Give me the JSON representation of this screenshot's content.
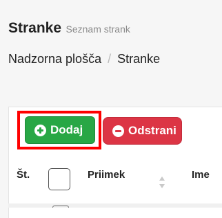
{
  "header": {
    "title": "Stranke",
    "subtitle": "Seznam strank"
  },
  "breadcrumb": {
    "items": [
      "Nadzorna plošča",
      "Stranke"
    ],
    "separator": "/"
  },
  "toolbar": {
    "add_label": "Dodaj",
    "add_icon": "plus-circle-icon",
    "remove_label": "Odstrani",
    "remove_icon": "minus-circle-icon",
    "add_color": "#28a745",
    "remove_color": "#dc3545",
    "highlight_color": "#ff0000"
  },
  "table": {
    "columns": {
      "number": "Št.",
      "surname": "Priimek",
      "name": "Ime"
    },
    "sort_icon": "sort-updown-icon",
    "select_all_checked": false
  }
}
